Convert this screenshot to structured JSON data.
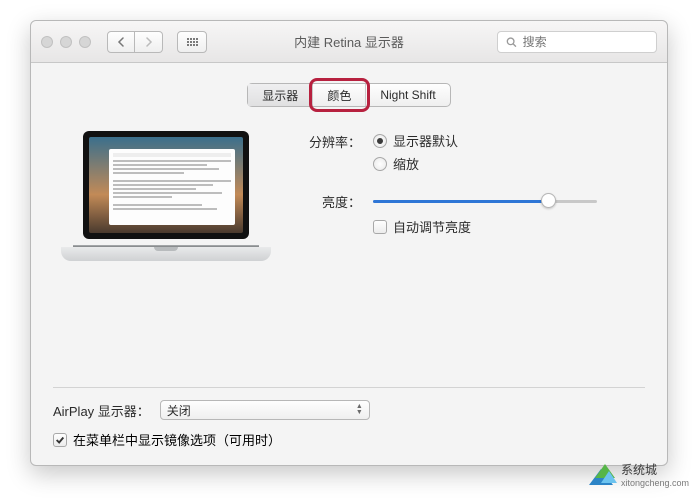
{
  "window": {
    "title": "内建 Retina 显示器"
  },
  "search": {
    "placeholder": "搜索"
  },
  "tabs": {
    "items": [
      {
        "label": "显示器",
        "active": true
      },
      {
        "label": "颜色",
        "active": false
      },
      {
        "label": "Night Shift",
        "active": false
      }
    ],
    "highlighted_index": 1
  },
  "resolution": {
    "label": "分辨率：",
    "options": [
      {
        "label": "显示器默认",
        "checked": true
      },
      {
        "label": "缩放",
        "checked": false
      }
    ]
  },
  "brightness": {
    "label": "亮度：",
    "value_percent": 78,
    "auto_label": "自动调节亮度",
    "auto_checked": false
  },
  "airplay": {
    "label": "AirPlay 显示器：",
    "selected": "关闭"
  },
  "menubar_mirror": {
    "label": "在菜单栏中显示镜像选项（可用时）",
    "checked": true
  },
  "watermark": {
    "name": "系统城",
    "url": "xitongcheng.com"
  }
}
